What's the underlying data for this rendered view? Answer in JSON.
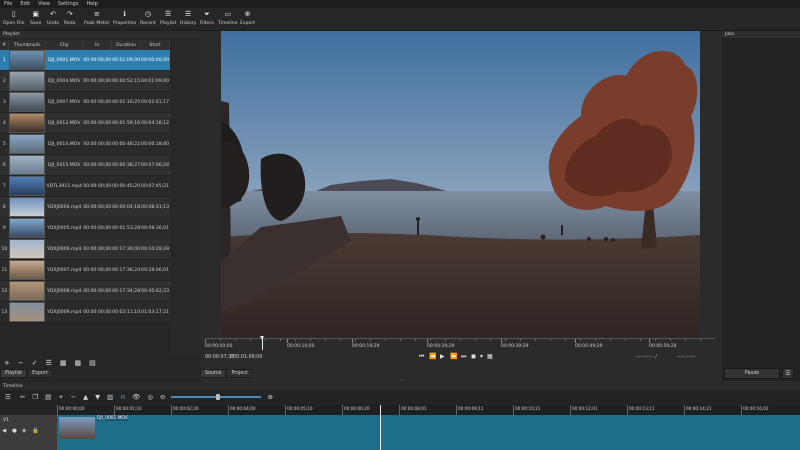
{
  "menu": [
    "File",
    "Edit",
    "View",
    "Settings",
    "Help"
  ],
  "toolbar": [
    {
      "label": "Open File",
      "icon": "open-file-icon",
      "glyph": "▯"
    },
    {
      "label": "Save",
      "icon": "save-icon",
      "glyph": "▣"
    },
    {
      "label": "Undo",
      "icon": "undo-icon",
      "glyph": "↶"
    },
    {
      "label": "Redo",
      "icon": "redo-icon",
      "glyph": "↷"
    },
    {
      "label": "Peak Meter",
      "icon": "peak-meter-icon",
      "glyph": "≡"
    },
    {
      "label": "Properties",
      "icon": "properties-icon",
      "glyph": "ℹ"
    },
    {
      "label": "Recent",
      "icon": "recent-icon",
      "glyph": "◷"
    },
    {
      "label": "Playlist",
      "icon": "playlist-icon",
      "glyph": "☰"
    },
    {
      "label": "History",
      "icon": "history-icon",
      "glyph": "☰"
    },
    {
      "label": "Filters",
      "icon": "filters-icon",
      "glyph": "⏷"
    },
    {
      "label": "Timeline",
      "icon": "timeline-icon",
      "glyph": "▭"
    },
    {
      "label": "Export",
      "icon": "export-icon",
      "glyph": "⊕"
    }
  ],
  "playlist": {
    "title": "Playlist",
    "columns": [
      "#",
      "Thumbnails",
      "Clip",
      "In",
      "Duration",
      "Start"
    ],
    "rows": [
      {
        "n": "1",
        "clip": "DJI_0001.MOV",
        "in": "00:00:00;00",
        "duration": "00:01:09;00",
        "start": "00:00:00;00",
        "selected": true
      },
      {
        "n": "2",
        "clip": "DJI_0004.MOV",
        "in": "00:00:00;00",
        "duration": "00:00:52;15",
        "start": "00:01:09;00"
      },
      {
        "n": "3",
        "clip": "DJI_0007.MOV",
        "in": "00:00:00;00",
        "duration": "00:02:16;25",
        "start": "00:02:01;17"
      },
      {
        "n": "4",
        "clip": "DJI_0012.MOV",
        "in": "00:00:00;00",
        "duration": "00:01:59;16",
        "start": "00:04:18;12"
      },
      {
        "n": "5",
        "clip": "DJI_0014.MOV",
        "in": "00:00:00;00",
        "duration": "00:00:48;22",
        "start": "00:06:18;00"
      },
      {
        "n": "6",
        "clip": "DJI_0015.MOV",
        "in": "00:00:00;00",
        "duration": "00:00:38;27",
        "start": "00:07:06;24"
      },
      {
        "n": "7",
        "clip": "VDTL3915.mp4",
        "in": "00:00:00;00",
        "duration": "00:00:45;20",
        "start": "00:07:45;21"
      },
      {
        "n": "8",
        "clip": "YDXJ0004.mp4",
        "in": "00:00:00;00",
        "duration": "00:00:04;18",
        "start": "00:08:31;13"
      },
      {
        "n": "9",
        "clip": "YDXJ0005.mp4",
        "in": "00:00:00;00",
        "duration": "00:01:53;28",
        "start": "00:08:36;01"
      },
      {
        "n": "10",
        "clip": "YDXJ0006.mp4",
        "in": "00:00:00;00",
        "duration": "00:17:36;00",
        "start": "00:10:29;29"
      },
      {
        "n": "11",
        "clip": "YDXJ0007.mp4",
        "in": "00:00:00;00",
        "duration": "00:17:36;24",
        "start": "00:28:06;01"
      },
      {
        "n": "12",
        "clip": "YDXJ0008.mp4",
        "in": "00:00:00;00",
        "duration": "00:17:34;28",
        "start": "00:45:42;23"
      },
      {
        "n": "13",
        "clip": "YDXJ0009.mp4",
        "in": "00:00:00;00",
        "duration": "00:03:11;10",
        "start": "01:03:17;21"
      }
    ],
    "tabs": [
      "Playlist",
      "Export"
    ]
  },
  "player": {
    "ruler_labels": [
      "00:00:00;00",
      "00:00:10;00",
      "00:00:19;29",
      "00:00:29;29",
      "00:00:39;29",
      "00:00:49;29",
      "00:00:59;28"
    ],
    "position": "00:00:07;38",
    "duration": "/ 00:01:09;00",
    "in_point": "--:--:--:-- /",
    "out_point": "--:--:--:--",
    "tabs": [
      "Source",
      "Project"
    ]
  },
  "jobs": {
    "title": "Jobs",
    "pause_label": "Pause"
  },
  "timeline": {
    "title": "Timeline",
    "ruler_labels": [
      "00:00:00;00",
      "00:00:01;10",
      "00:00:02;20",
      "00:00:04;00",
      "00:00:05;10",
      "00:00:06;20",
      "00:00:08;01",
      "00:00:09;11",
      "00:00:10;21",
      "00:00:12;01",
      "00:00:13;11",
      "00:00:14;21",
      "00:00:16;02"
    ],
    "track_label": "V1",
    "clip_label": "DJI_0001.MOV"
  }
}
